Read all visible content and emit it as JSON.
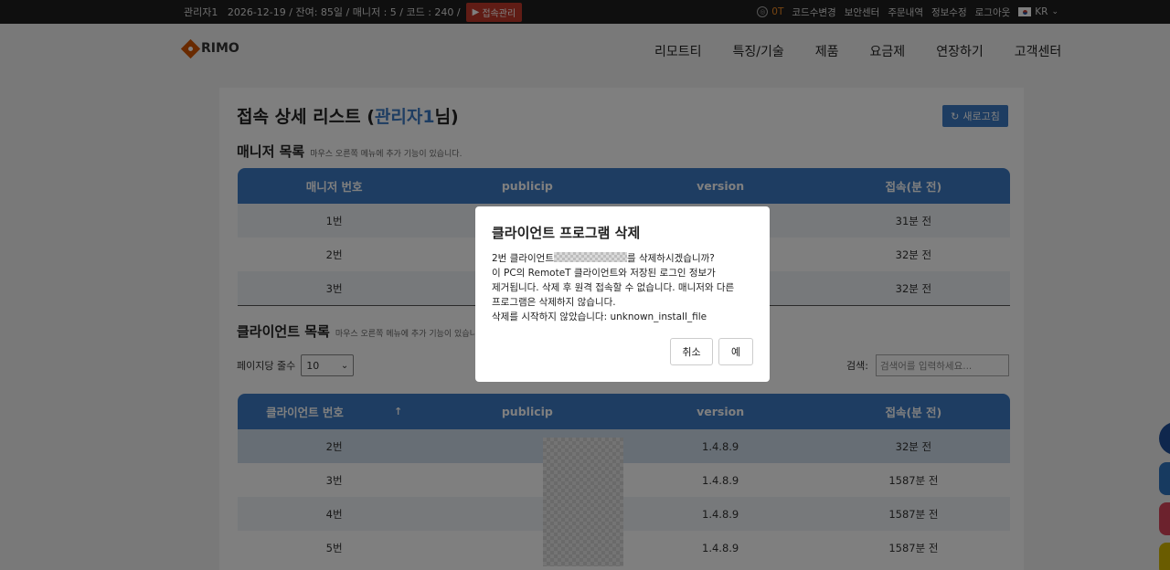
{
  "topbar": {
    "info": "관리자1   2026-12-19 / 잔여: 85일 / 매니저 : 5 / 코드 : 240 /",
    "conn_btn": "접속관리",
    "points": "0T",
    "links": [
      "코드수변경",
      "보안센터",
      "주문내역",
      "정보수정",
      "로그아웃"
    ],
    "lang": "KR"
  },
  "header": {
    "logo": "RIMO",
    "nav": [
      "리모트티",
      "특징/기술",
      "제품",
      "요금제",
      "연장하기",
      "고객센터"
    ]
  },
  "page": {
    "title_prefix": "접속 상세 리스트 (",
    "title_user": "관리자1",
    "title_suffix": "님)",
    "refresh": "새로고침"
  },
  "manager_section": {
    "title": "매니저 목록",
    "hint": "마우스 오른쪽 메뉴에 추가 기능이 있습니다.",
    "columns": [
      "매니저 번호",
      "publicip",
      "version",
      "접속(분 전)"
    ],
    "rows": [
      {
        "no": "1번",
        "ago": "31분 전"
      },
      {
        "no": "2번",
        "ago": "32분 전"
      },
      {
        "no": "3번",
        "ago": "32분 전"
      }
    ]
  },
  "client_section": {
    "title": "클라이언트 목록",
    "hint": "마우스 오른쪽 메뉴에 추가 기능이 있습니다.",
    "page_size_label": "페이지당 줄수",
    "page_size": "10",
    "search_label": "검색:",
    "search_placeholder": "검색어를 입력하세요...",
    "columns": [
      "클라이언트 번호",
      "publicip",
      "version",
      "접속(분 전)"
    ],
    "sort_arrow": "↑",
    "rows": [
      {
        "no": "2번",
        "version": "1.4.8.9",
        "ago": "32분 전"
      },
      {
        "no": "3번",
        "version": "1.4.8.9",
        "ago": "1587분 전"
      },
      {
        "no": "4번",
        "version": "1.4.8.9",
        "ago": "1587분 전"
      },
      {
        "no": "5번",
        "version": "1.4.8.9",
        "ago": "1587분 전"
      }
    ]
  },
  "modal": {
    "title": "클라이언트 프로그램 삭제",
    "line1_prefix": "2번 클라이언트",
    "line1_suffix": "를 삭제하시겠습니까?",
    "line2": "이 PC의 RemoteT 클라이언트와 저장된 로그인 정보가",
    "line3": "제거됩니다. 삭제 후 원격 접속할 수 없습니다. 매니저와 다른",
    "line4": "프로그램은 삭제하지 않습니다.",
    "line5": "삭제를 시작하지 않았습니다: unknown_install_file",
    "cancel": "취소",
    "confirm": "예"
  },
  "colors": {
    "primary": "#3d7bc4",
    "topbar": "#1f1f1f",
    "conn_btn": "#c0392b",
    "side_widgets": [
      "#1f4e9a",
      "#2f74c0",
      "#d9455a",
      "#d4b800"
    ]
  }
}
